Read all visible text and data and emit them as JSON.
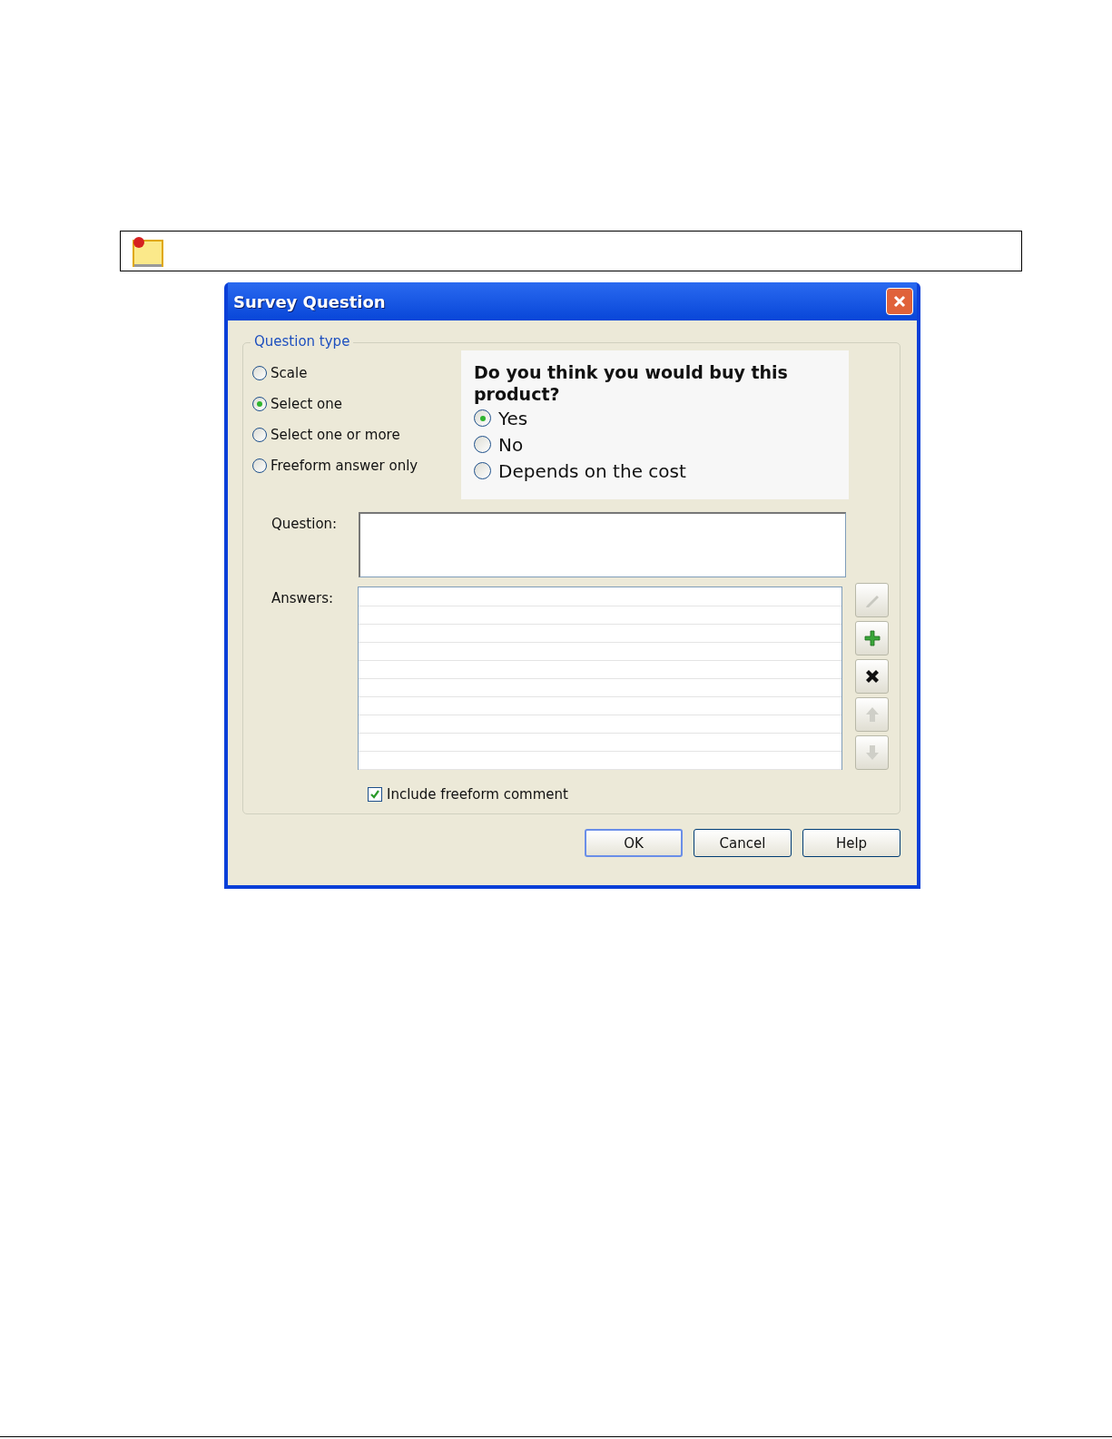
{
  "dialog": {
    "title": "Survey Question",
    "question_type": {
      "legend": "Question type",
      "options": [
        {
          "label": "Scale",
          "selected": false
        },
        {
          "label": "Select one",
          "selected": true
        },
        {
          "label": "Select one or more",
          "selected": false
        },
        {
          "label": "Freeform answer only",
          "selected": false
        }
      ]
    },
    "preview": {
      "question": "Do you think you would buy this product?",
      "options": [
        {
          "label": "Yes",
          "selected": true
        },
        {
          "label": "No",
          "selected": false
        },
        {
          "label": "Depends on the cost",
          "selected": false
        }
      ]
    },
    "question_field": {
      "label": "Question:"
    },
    "answers": {
      "label": "Answers:",
      "tools": [
        {
          "kind": "edit",
          "disabled": true
        },
        {
          "kind": "add",
          "disabled": false
        },
        {
          "kind": "delete",
          "disabled": false
        },
        {
          "kind": "up",
          "disabled": true
        },
        {
          "kind": "down",
          "disabled": true
        }
      ]
    },
    "include_comment": {
      "label": "Include freeform comment",
      "checked": true
    },
    "buttons": [
      {
        "label": "OK",
        "default": true
      },
      {
        "label": "Cancel",
        "default": false
      },
      {
        "label": "Help",
        "default": false
      }
    ]
  }
}
